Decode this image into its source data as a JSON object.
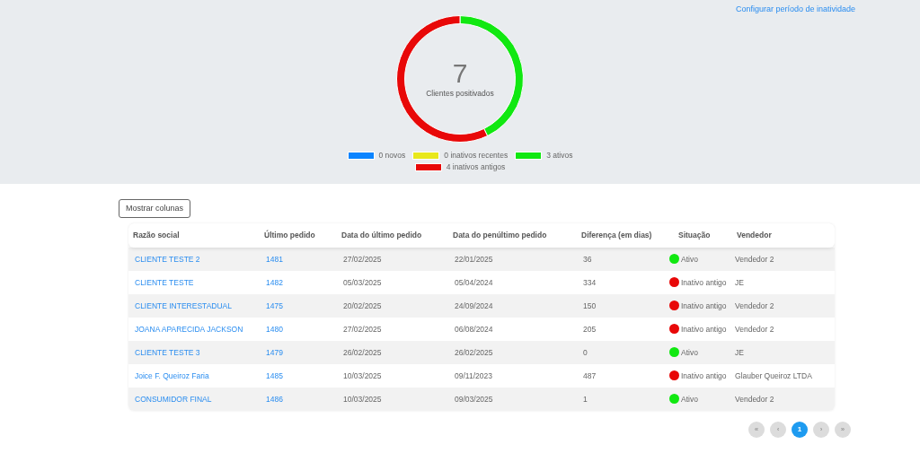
{
  "header": {
    "config_link": "Configurar período de inatividade"
  },
  "summary": {
    "total": "7",
    "caption": "Clientes positivados",
    "chart_data": {
      "type": "donut",
      "categories": [
        "0 novos",
        "0 inativos recentes",
        "3 ativos",
        "4 inativos antigos"
      ],
      "values": [
        0,
        0,
        3,
        4
      ]
    },
    "legend": [
      {
        "color": "#0a84ff"
      },
      {
        "color": "#e8e81c"
      },
      {
        "color": "#11e811"
      },
      {
        "color": "#e80808"
      }
    ]
  },
  "columns_button": "Mostrar colunas",
  "table": {
    "columns": [
      "Razão social",
      "Último pedido",
      "Data do último pedido",
      "Data do penúltimo pedido",
      "Diferença (em dias)",
      "Situação",
      "Vendedor"
    ],
    "rows": [
      {
        "name": "CLIENTE TESTE 2",
        "order": "1481",
        "last": "27/02/2025",
        "prev": "22/01/2025",
        "diff": "36",
        "status": "Ativo",
        "color": "#11e811",
        "seller": "Vendedor 2"
      },
      {
        "name": "CLIENTE TESTE",
        "order": "1482",
        "last": "05/03/2025",
        "prev": "05/04/2024",
        "diff": "334",
        "status": "Inativo antigo",
        "color": "#e80808",
        "seller": "JE"
      },
      {
        "name": "CLIENTE INTERESTADUAL",
        "order": "1475",
        "last": "20/02/2025",
        "prev": "24/09/2024",
        "diff": "150",
        "status": "Inativo antigo",
        "color": "#e80808",
        "seller": "Vendedor 2"
      },
      {
        "name": "JOANA APARECIDA JACKSON",
        "order": "1480",
        "last": "27/02/2025",
        "prev": "06/08/2024",
        "diff": "205",
        "status": "Inativo antigo",
        "color": "#e80808",
        "seller": "Vendedor 2"
      },
      {
        "name": "CLIENTE TESTE 3",
        "order": "1479",
        "last": "26/02/2025",
        "prev": "26/02/2025",
        "diff": "0",
        "status": "Ativo",
        "color": "#11e811",
        "seller": "JE"
      },
      {
        "name": "Joice F. Queiroz Faria",
        "order": "1485",
        "last": "10/03/2025",
        "prev": "09/11/2023",
        "diff": "487",
        "status": "Inativo antigo",
        "color": "#e80808",
        "seller": "Glauber Queiroz LTDA"
      },
      {
        "name": "CONSUMIDOR FINAL",
        "order": "1486",
        "last": "10/03/2025",
        "prev": "09/03/2025",
        "diff": "1",
        "status": "Ativo",
        "color": "#11e811",
        "seller": "Vendedor 2"
      }
    ]
  },
  "pagination": [
    {
      "label": "«",
      "selected": false
    },
    {
      "label": "‹",
      "selected": false
    },
    {
      "label": "1",
      "selected": true
    },
    {
      "label": "›",
      "selected": false
    },
    {
      "label": "»",
      "selected": false
    }
  ]
}
